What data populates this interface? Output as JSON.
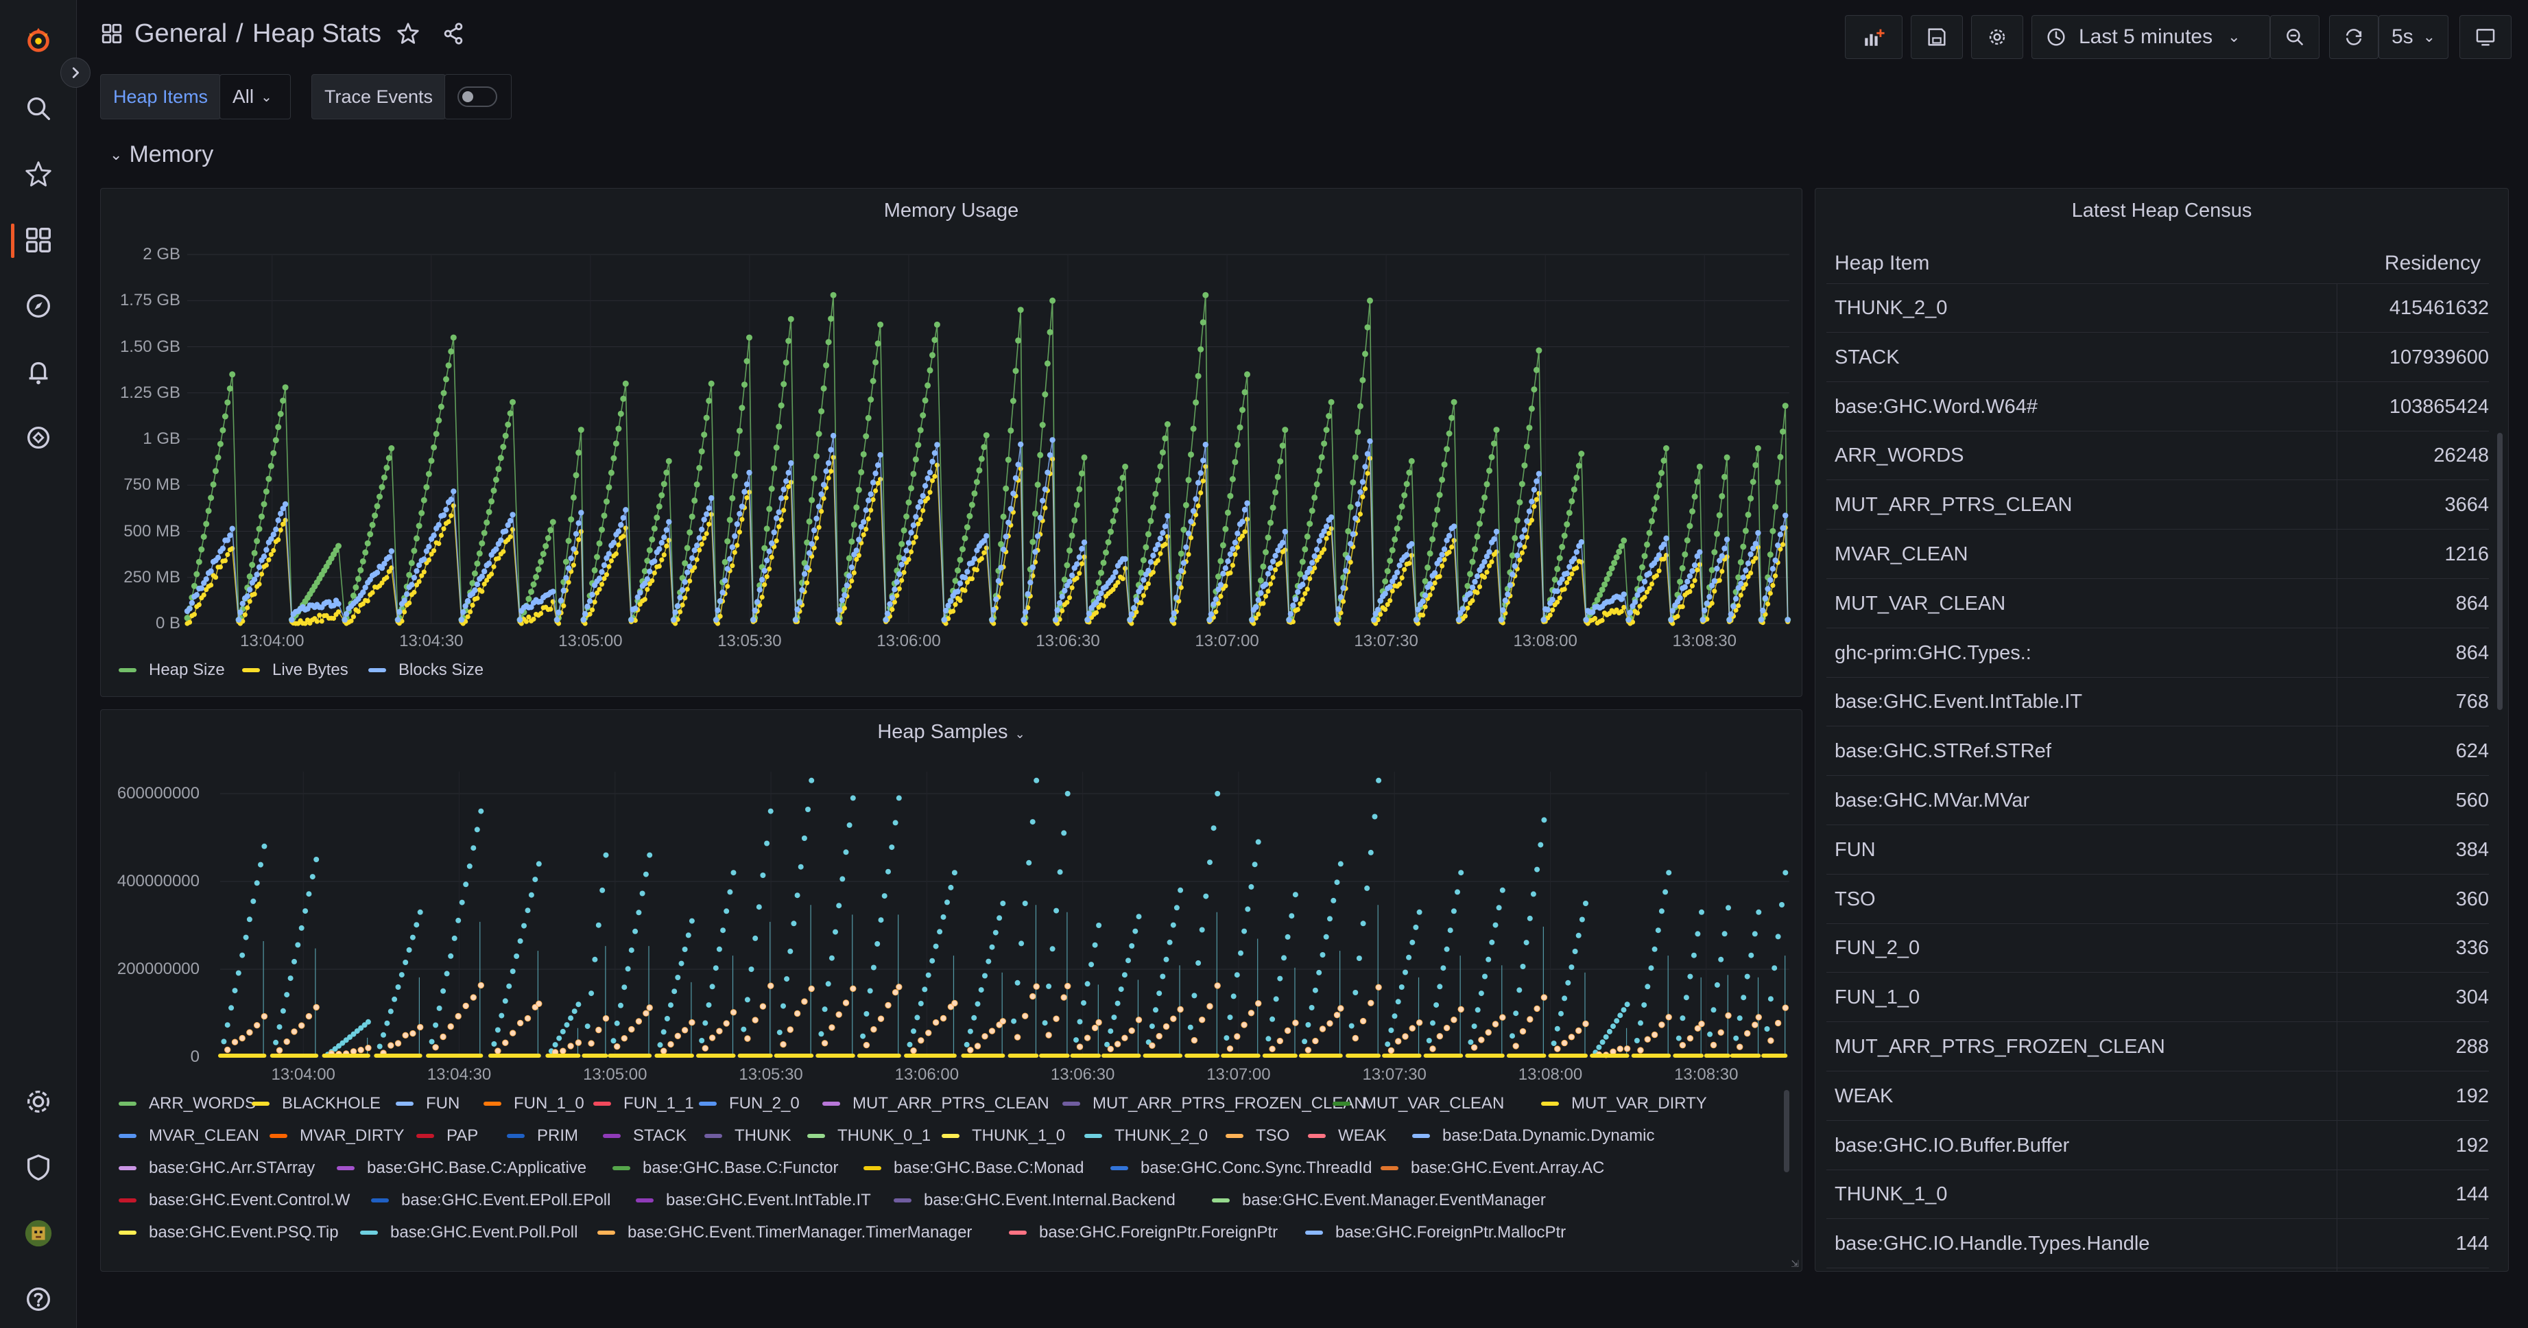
{
  "breadcrumb": {
    "folder": "General",
    "separator": "/",
    "dashboard": "Heap Stats"
  },
  "toolbar": {
    "time_range": "Last 5 minutes",
    "refresh_interval": "5s"
  },
  "variables": {
    "heap_items_label": "Heap Items",
    "heap_items_value": "All",
    "trace_events_label": "Trace Events",
    "trace_events_enabled": false
  },
  "row": {
    "title": "Memory"
  },
  "memory_panel": {
    "title": "Memory Usage",
    "y_ticks": [
      "2 GB",
      "1.75 GB",
      "1.50 GB",
      "1.25 GB",
      "1 GB",
      "750 MB",
      "500 MB",
      "250 MB",
      "0 B"
    ],
    "x_ticks": [
      "13:04:00",
      "13:04:30",
      "13:05:00",
      "13:05:30",
      "13:06:00",
      "13:06:30",
      "13:07:00",
      "13:07:30",
      "13:08:00",
      "13:08:30"
    ],
    "legend": [
      {
        "label": "Heap Size",
        "color": "#73bf69"
      },
      {
        "label": "Live Bytes",
        "color": "#fade2a"
      },
      {
        "label": "Blocks Size",
        "color": "#8ab8ff"
      }
    ]
  },
  "samples_panel": {
    "title": "Heap Samples",
    "y_ticks": [
      "600000000",
      "400000000",
      "200000000",
      "0"
    ],
    "x_ticks": [
      "13:04:00",
      "13:04:30",
      "13:05:00",
      "13:05:30",
      "13:06:00",
      "13:06:30",
      "13:07:00",
      "13:07:30",
      "13:08:00",
      "13:08:30"
    ],
    "legend": [
      {
        "label": "ARR_WORDS",
        "color": "#73bf69"
      },
      {
        "label": "BLACKHOLE",
        "color": "#fade2a"
      },
      {
        "label": "FUN",
        "color": "#8ab8ff"
      },
      {
        "label": "FUN_1_0",
        "color": "#ff780a"
      },
      {
        "label": "FUN_1_1",
        "color": "#f2495c"
      },
      {
        "label": "FUN_2_0",
        "color": "#5794f2"
      },
      {
        "label": "MUT_ARR_PTRS_CLEAN",
        "color": "#b877d9"
      },
      {
        "label": "MUT_ARR_PTRS_FROZEN_CLEAN",
        "color": "#705da0"
      },
      {
        "label": "MUT_VAR_CLEAN",
        "color": "#37872d"
      },
      {
        "label": "MUT_VAR_DIRTY",
        "color": "#fade2a"
      },
      {
        "label": "MVAR_CLEAN",
        "color": "#5794f2"
      },
      {
        "label": "MVAR_DIRTY",
        "color": "#fa6400"
      },
      {
        "label": "PAP",
        "color": "#c4162a"
      },
      {
        "label": "PRIM",
        "color": "#1f60c4"
      },
      {
        "label": "STACK",
        "color": "#8f3bb8"
      },
      {
        "label": "THUNK",
        "color": "#705da0"
      },
      {
        "label": "THUNK_0_1",
        "color": "#96d98d"
      },
      {
        "label": "THUNK_1_0",
        "color": "#ffee52"
      },
      {
        "label": "THUNK_2_0",
        "color": "#6ed0e0"
      },
      {
        "label": "TSO",
        "color": "#ffb357"
      },
      {
        "label": "WEAK",
        "color": "#ff7383"
      },
      {
        "label": "base:Data.Dynamic.Dynamic",
        "color": "#8ab8ff"
      },
      {
        "label": "base:GHC.Arr.STArray",
        "color": "#ca95e5"
      },
      {
        "label": "base:GHC.Base.C:Applicative",
        "color": "#a352cc"
      },
      {
        "label": "base:GHC.Base.C:Functor",
        "color": "#56a64b"
      },
      {
        "label": "base:GHC.Base.C:Monad",
        "color": "#f2cc0c"
      },
      {
        "label": "base:GHC.Conc.Sync.ThreadId",
        "color": "#3274d9"
      },
      {
        "label": "base:GHC.Event.Array.AC",
        "color": "#e0752d"
      },
      {
        "label": "base:GHC.Event.Control.W",
        "color": "#c4162a"
      },
      {
        "label": "base:GHC.Event.EPoll.EPoll",
        "color": "#1f60c4"
      },
      {
        "label": "base:GHC.Event.IntTable.IT",
        "color": "#8f3bb8"
      },
      {
        "label": "base:GHC.Event.Internal.Backend",
        "color": "#705da0"
      },
      {
        "label": "base:GHC.Event.Manager.EventManager",
        "color": "#96d98d"
      },
      {
        "label": "base:GHC.Event.PSQ.Tip",
        "color": "#ffee52"
      },
      {
        "label": "base:GHC.Event.Poll.Poll",
        "color": "#6ed0e0"
      },
      {
        "label": "base:GHC.Event.TimerManager.TimerManager",
        "color": "#ffb357"
      },
      {
        "label": "base:GHC.ForeignPtr.ForeignPtr",
        "color": "#ff7383"
      },
      {
        "label": "base:GHC.ForeignPtr.MallocPtr",
        "color": "#8ab8ff"
      }
    ]
  },
  "census_panel": {
    "title": "Latest Heap Census",
    "columns": [
      "Heap Item",
      "Residency"
    ],
    "rows": [
      {
        "name": "THUNK_2_0",
        "value": "415461632"
      },
      {
        "name": "STACK",
        "value": "107939600"
      },
      {
        "name": "base:GHC.Word.W64#",
        "value": "103865424"
      },
      {
        "name": "ARR_WORDS",
        "value": "26248"
      },
      {
        "name": "MUT_ARR_PTRS_CLEAN",
        "value": "3664"
      },
      {
        "name": "MVAR_CLEAN",
        "value": "1216"
      },
      {
        "name": "MUT_VAR_CLEAN",
        "value": "864"
      },
      {
        "name": "ghc-prim:GHC.Types.:",
        "value": "864"
      },
      {
        "name": "base:GHC.Event.IntTable.IT",
        "value": "768"
      },
      {
        "name": "base:GHC.STRef.STRef",
        "value": "624"
      },
      {
        "name": "base:GHC.MVar.MVar",
        "value": "560"
      },
      {
        "name": "FUN",
        "value": "384"
      },
      {
        "name": "TSO",
        "value": "360"
      },
      {
        "name": "FUN_2_0",
        "value": "336"
      },
      {
        "name": "FUN_1_0",
        "value": "304"
      },
      {
        "name": "MUT_ARR_PTRS_FROZEN_CLEAN",
        "value": "288"
      },
      {
        "name": "WEAK",
        "value": "192"
      },
      {
        "name": "base:GHC.IO.Buffer.Buffer",
        "value": "192"
      },
      {
        "name": "THUNK_1_0",
        "value": "144"
      },
      {
        "name": "base:GHC.IO.Handle.Types.Handle",
        "value": "144"
      }
    ]
  },
  "chart_data": [
    {
      "type": "scatter",
      "title": "Memory Usage",
      "ylabel": "",
      "xlabel": "",
      "y_unit": "GB",
      "ylim": [
        0,
        2
      ],
      "x_range": [
        "13:03:44",
        "13:08:46"
      ],
      "grid": true,
      "legend_position": "bottom-left",
      "cycles": {
        "starts_sec": [
          0,
          10,
          20,
          30,
          40,
          52,
          63,
          70,
          75,
          84,
          92,
          100,
          107,
          115,
          123,
          132,
          143,
          152,
          158,
          164,
          170,
          178,
          186,
          193,
          201,
          208,
          217,
          224,
          232,
          240,
          248,
          256,
          264,
          272,
          280,
          286,
          291,
          297
        ],
        "peak_heap_gb": [
          1.35,
          1.28,
          0.42,
          0.95,
          1.55,
          1.2,
          0.55,
          1.05,
          1.3,
          0.88,
          1.3,
          1.55,
          1.65,
          1.78,
          1.62,
          1.62,
          1.02,
          1.7,
          1.75,
          0.9,
          0.85,
          1.08,
          1.78,
          1.35,
          1.05,
          1.2,
          1.75,
          0.88,
          1.2,
          1.05,
          1.48,
          0.92,
          0.45,
          0.95,
          0.85,
          0.9,
          0.95,
          1.18
        ],
        "peak_live_gb": [
          0.42,
          0.55,
          0.05,
          0.3,
          0.62,
          0.5,
          0.1,
          0.5,
          0.52,
          0.45,
          0.58,
          0.72,
          0.78,
          0.9,
          0.8,
          0.85,
          0.4,
          0.85,
          0.88,
          0.35,
          0.28,
          0.48,
          0.85,
          0.55,
          0.4,
          0.5,
          0.88,
          0.35,
          0.45,
          0.4,
          0.72,
          0.35,
          0.08,
          0.38,
          0.3,
          0.38,
          0.4,
          0.5
        ]
      },
      "series": [
        {
          "name": "Heap Size",
          "color": "#73bf69"
        },
        {
          "name": "Live Bytes",
          "color": "#fade2a"
        },
        {
          "name": "Blocks Size",
          "color": "#8ab8ff"
        }
      ]
    },
    {
      "type": "scatter",
      "title": "Heap Samples",
      "ylim": [
        0,
        650000000
      ],
      "x_range": [
        "13:03:44",
        "13:08:46"
      ],
      "grid": true,
      "legend_position": "bottom",
      "cycles": {
        "starts_sec": [
          0,
          10,
          20,
          30,
          40,
          52,
          63,
          70,
          75,
          84,
          92,
          100,
          107,
          115,
          123,
          132,
          143,
          152,
          158,
          164,
          170,
          178,
          186,
          193,
          201,
          208,
          217,
          224,
          232,
          240,
          248,
          256,
          264,
          272,
          280,
          286,
          291,
          297
        ],
        "peak_thunk_2_0": [
          480000000,
          450000000,
          80000000,
          330000000,
          560000000,
          440000000,
          120000000,
          460000000,
          460000000,
          310000000,
          420000000,
          560000000,
          630000000,
          590000000,
          590000000,
          420000000,
          350000000,
          630000000,
          600000000,
          300000000,
          320000000,
          380000000,
          600000000,
          490000000,
          370000000,
          440000000,
          630000000,
          330000000,
          420000000,
          380000000,
          540000000,
          350000000,
          120000000,
          420000000,
          330000000,
          340000000,
          330000000,
          420000000
        ],
        "peak_stack": [
          90000000,
          110000000,
          20000000,
          70000000,
          160000000,
          120000000,
          30000000,
          90000000,
          110000000,
          80000000,
          100000000,
          160000000,
          160000000,
          160000000,
          160000000,
          120000000,
          80000000,
          160000000,
          160000000,
          80000000,
          80000000,
          110000000,
          160000000,
          120000000,
          80000000,
          110000000,
          160000000,
          80000000,
          110000000,
          90000000,
          140000000,
          80000000,
          20000000,
          90000000,
          80000000,
          90000000,
          90000000,
          110000000
        ]
      },
      "series": [
        {
          "name": "THUNK_2_0",
          "color": "#6ed0e0"
        },
        {
          "name": "STACK",
          "color": "#ffb357"
        },
        {
          "name": "BLACKHOLE",
          "color": "#fade2a"
        }
      ]
    }
  ]
}
